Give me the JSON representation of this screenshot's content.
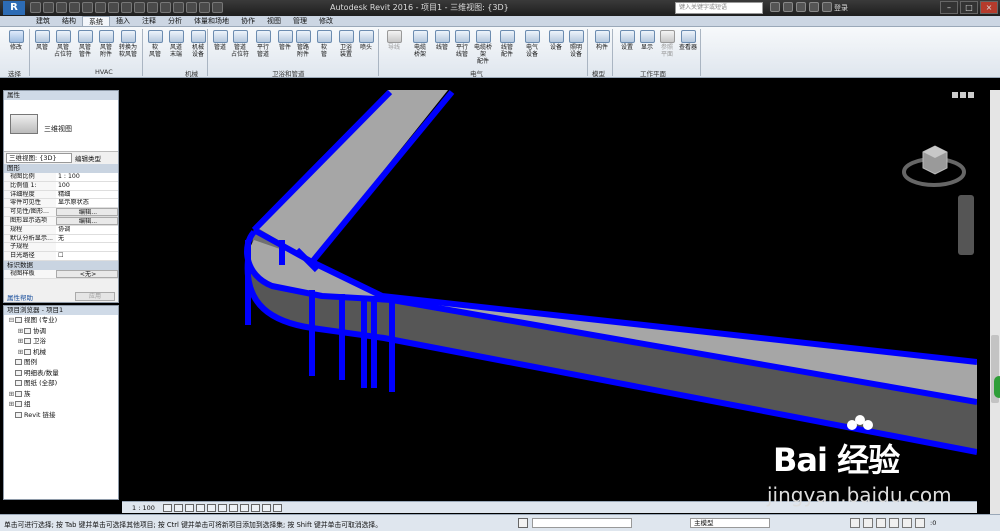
{
  "title_bar": {
    "app_logo": "R",
    "title": "Autodesk Revit 2016 -   项目1 - 三维视图: {3D}",
    "search_placeholder": "键入关键字或短语",
    "signin": "登录",
    "min": "–",
    "max": "□",
    "close": "×"
  },
  "tabs": [
    "建筑",
    "结构",
    "系统",
    "插入",
    "注释",
    "分析",
    "体量和场地",
    "协作",
    "视图",
    "管理",
    "修改"
  ],
  "active_tab": "系统",
  "ribbon": {
    "tools": [
      {
        "label": "修改",
        "icon": "cursor-icon"
      },
      {
        "label": "风管",
        "icon": "duct-icon"
      },
      {
        "label": "风管\n占位符",
        "icon": "duct-placeholder-icon"
      },
      {
        "label": "风管\n管件",
        "icon": "duct-fitting-icon"
      },
      {
        "label": "风管\n附件",
        "icon": "duct-accessory-icon"
      },
      {
        "label": "转换为\n软风管",
        "icon": "convert-flex-icon"
      },
      {
        "label": "软\n风管",
        "icon": "flex-duct-icon"
      },
      {
        "label": "风道\n末端",
        "icon": "air-terminal-icon"
      },
      {
        "label": "机械\n设备",
        "icon": "mech-equipment-icon"
      },
      {
        "label": "管道",
        "icon": "pipe-icon"
      },
      {
        "label": "管道\n占位符",
        "icon": "pipe-placeholder-icon"
      },
      {
        "label": "平行\n管道",
        "icon": "parallel-pipe-icon"
      },
      {
        "label": "管件",
        "icon": "pipe-fitting-icon"
      },
      {
        "label": "管路\n附件",
        "icon": "pipe-accessory-icon"
      },
      {
        "label": "软\n管",
        "icon": "flex-pipe-icon"
      },
      {
        "label": "卫浴\n装置",
        "icon": "plumbing-fixture-icon"
      },
      {
        "label": "喷头",
        "icon": "sprinkler-icon"
      },
      {
        "label": "导线",
        "icon": "wire-icon",
        "disabled": true
      },
      {
        "label": "电缆\n桥架",
        "icon": "cable-tray-icon"
      },
      {
        "label": "线管",
        "icon": "conduit-icon"
      },
      {
        "label": "平行\n线管",
        "icon": "parallel-conduit-icon"
      },
      {
        "label": "电缆桥架\n配件",
        "icon": "tray-fitting-icon"
      },
      {
        "label": "线管\n配件",
        "icon": "conduit-fitting-icon"
      },
      {
        "label": "电气\n设备",
        "icon": "electrical-equipment-icon"
      },
      {
        "label": "设备",
        "icon": "device-icon"
      },
      {
        "label": "照明\n设备",
        "icon": "lighting-fixture-icon"
      },
      {
        "label": "构件",
        "icon": "component-icon"
      },
      {
        "label": "设置",
        "icon": "workplane-set-icon"
      },
      {
        "label": "显示",
        "icon": "workplane-show-icon"
      },
      {
        "label": "参照\n平面",
        "icon": "ref-plane-icon",
        "disabled": true
      },
      {
        "label": "查看器",
        "icon": "viewer-icon"
      }
    ],
    "panels": [
      "选择",
      "HVAC",
      "机械",
      "卫浴和管道",
      "电气",
      "模型",
      "工作平面"
    ]
  },
  "properties": {
    "title": "属性",
    "type_name": "三维视图",
    "selector": "三维视图: {3D}",
    "edit_type": "编辑类型",
    "section_graphics": "图形",
    "rows": [
      {
        "k": "视图比例",
        "v": "1 : 100"
      },
      {
        "k": "比例值 1:",
        "v": "100"
      },
      {
        "k": "详细程度",
        "v": "精细"
      },
      {
        "k": "零件可见性",
        "v": "显示原状态"
      },
      {
        "k": "可见性/图形...",
        "v": "编辑..."
      },
      {
        "k": "图形显示选项",
        "v": "编辑..."
      },
      {
        "k": "规程",
        "v": "协调"
      },
      {
        "k": "默认分析显示...",
        "v": "无"
      },
      {
        "k": "子规程",
        "v": ""
      },
      {
        "k": "日光路径",
        "v": "☐"
      }
    ],
    "section_identity": "标识数据",
    "identity_rows": [
      {
        "k": "视图样板",
        "v": "<无>"
      }
    ],
    "help": "属性帮助",
    "apply": "应用"
  },
  "browser": {
    "title": "项目浏览器 - 项目1",
    "items": [
      {
        "label": "视图 (专业)",
        "indent": 0,
        "toggle": "⊟"
      },
      {
        "label": "协调",
        "indent": 1,
        "toggle": "⊞"
      },
      {
        "label": "卫浴",
        "indent": 1,
        "toggle": "⊞"
      },
      {
        "label": "机械",
        "indent": 1,
        "toggle": "⊞"
      },
      {
        "label": "图例",
        "indent": 0,
        "toggle": ""
      },
      {
        "label": "明细表/数量",
        "indent": 0,
        "toggle": ""
      },
      {
        "label": "图纸 (全部)",
        "indent": 0,
        "toggle": ""
      },
      {
        "label": "族",
        "indent": 0,
        "toggle": "⊞"
      },
      {
        "label": "组",
        "indent": 0,
        "toggle": "⊞"
      },
      {
        "label": "Revit 链接",
        "indent": 0,
        "toggle": ""
      }
    ]
  },
  "view_control": {
    "scale": "1 : 100"
  },
  "status": {
    "text": "单击可进行选择; 按 Tab 键并单击可选择其他项目; 按 Ctrl 键并单击可将新项目添加到选择集; 按 Shift 键并单击可取消选择。",
    "model": "主模型",
    "filter_count": ":0"
  },
  "watermark": {
    "brand": "Bai 经验",
    "url": "jingyan.baidu.com"
  },
  "colors": {
    "duct_edge": "#0000ff",
    "duct_top": "#a6a6a6",
    "duct_side": "#5a5a5a",
    "viewport_bg": "#000000"
  }
}
